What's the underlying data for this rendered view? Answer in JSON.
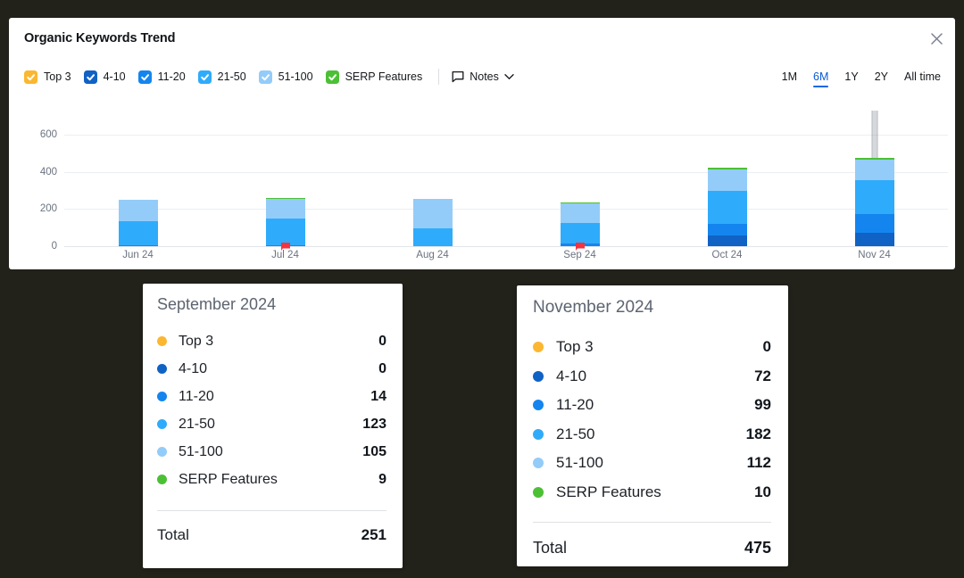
{
  "panel": {
    "title": "Organic Keywords Trend",
    "close_icon": "close-icon"
  },
  "legend": {
    "items": [
      {
        "label": "Top 3",
        "color": "#fbb731",
        "checked": true
      },
      {
        "label": "4-10",
        "color": "#1062c4",
        "checked": true
      },
      {
        "label": "11-20",
        "color": "#1485ee",
        "checked": true
      },
      {
        "label": "21-50",
        "color": "#2fabfb",
        "checked": true
      },
      {
        "label": "51-100",
        "color": "#93ccf9",
        "checked": true
      },
      {
        "label": "SERP Features",
        "color": "#4cc035",
        "checked": true
      }
    ],
    "notes": {
      "label": "Notes",
      "icon": "note-bubble-icon",
      "chevron": "chevron-down-icon"
    }
  },
  "range": {
    "options": [
      "1M",
      "6M",
      "1Y",
      "2Y",
      "All time"
    ],
    "selected": "6M"
  },
  "chart_data": {
    "type": "bar",
    "title": "Organic Keywords Trend",
    "xlabel": "",
    "ylabel": "",
    "stacked": true,
    "grid": true,
    "legend_position": "top-left",
    "ylim": [
      0,
      700
    ],
    "yticks": [
      0,
      200,
      400,
      600
    ],
    "categories": [
      "Jun 24",
      "Jul 24",
      "Aug 24",
      "Sep 24",
      "Oct 24",
      "Nov 24"
    ],
    "series": [
      {
        "name": "Top 3",
        "color": "#fbb731",
        "values": [
          0,
          0,
          0,
          0,
          0,
          0
        ]
      },
      {
        "name": "4-10",
        "color": "#1062c4",
        "values": [
          0,
          0,
          0,
          0,
          56,
          72
        ]
      },
      {
        "name": "11-20",
        "color": "#1485ee",
        "values": [
          6,
          7,
          0,
          14,
          63,
          99
        ]
      },
      {
        "name": "21-50",
        "color": "#2fabfb",
        "values": [
          126,
          140,
          97,
          109,
          177,
          182
        ]
      },
      {
        "name": "51-100",
        "color": "#93ccf9",
        "values": [
          119,
          105,
          155,
          105,
          116,
          112
        ]
      },
      {
        "name": "SERP Features",
        "color": "#4cc035",
        "values": [
          0,
          8,
          0,
          9,
          11,
          10
        ]
      }
    ],
    "totals": [
      251,
      260,
      252,
      251,
      423,
      475
    ],
    "note_markers": [
      "Jul 24",
      "Sep 24"
    ],
    "hover_category": "Nov 24"
  },
  "tooltips": [
    {
      "month": "September 2024",
      "rows": [
        {
          "label": "Top 3",
          "value": "0",
          "color": "#fbb731"
        },
        {
          "label": "4-10",
          "value": "0",
          "color": "#1062c4"
        },
        {
          "label": "11-20",
          "value": "14",
          "color": "#1485ee"
        },
        {
          "label": "21-50",
          "value": "123",
          "color": "#2fabfb"
        },
        {
          "label": "51-100",
          "value": "105",
          "color": "#93ccf9"
        },
        {
          "label": "SERP Features",
          "value": "9",
          "color": "#4cc035"
        }
      ],
      "total_label": "Total",
      "total_value": "251"
    },
    {
      "month": "November 2024",
      "rows": [
        {
          "label": "Top 3",
          "value": "0",
          "color": "#fbb731"
        },
        {
          "label": "4-10",
          "value": "72",
          "color": "#1062c4"
        },
        {
          "label": "11-20",
          "value": "99",
          "color": "#1485ee"
        },
        {
          "label": "21-50",
          "value": "182",
          "color": "#2fabfb"
        },
        {
          "label": "51-100",
          "value": "112",
          "color": "#93ccf9"
        },
        {
          "label": "SERP Features",
          "value": "10",
          "color": "#4cc035"
        }
      ],
      "total_label": "Total",
      "total_value": "475"
    }
  ]
}
